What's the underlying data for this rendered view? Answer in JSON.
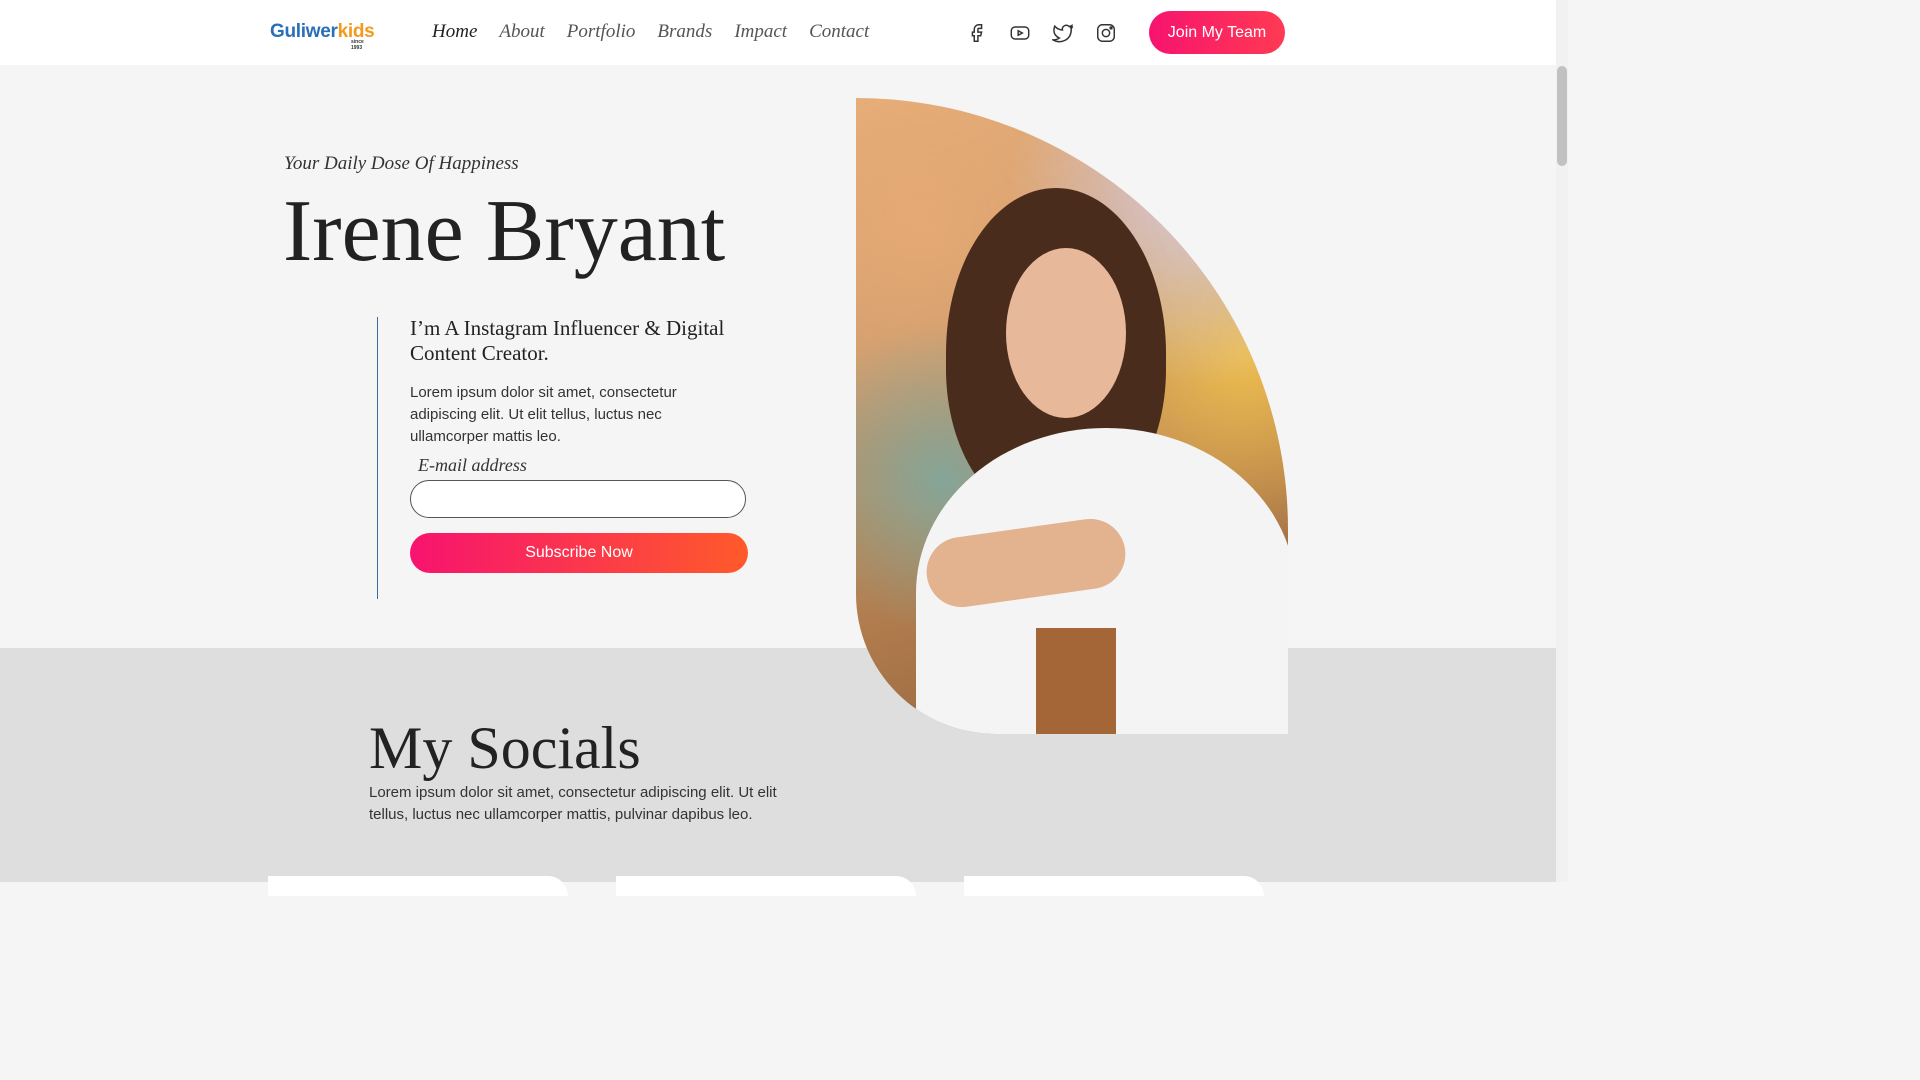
{
  "header": {
    "logo": {
      "main_a": "Guliwer",
      "main_b": "kids",
      "sub": "since 1993"
    },
    "nav": [
      {
        "label": "Home",
        "active": true
      },
      {
        "label": "About"
      },
      {
        "label": "Portfolio"
      },
      {
        "label": "Brands"
      },
      {
        "label": "Impact"
      },
      {
        "label": "Contact"
      }
    ],
    "social_icons": [
      "facebook-icon",
      "youtube-icon",
      "twitter-icon",
      "instagram-icon"
    ],
    "join_button": "Join My Team"
  },
  "hero": {
    "tagline": "Your Daily Dose Of Happiness",
    "name": "Irene Bryant",
    "subhead": "I’m A Instagram Influencer & Digital Content Creator.",
    "description": "Lorem ipsum dolor sit amet, consectetur adipiscing elit. Ut elit tellus, luctus nec ullamcorper mattis leo.",
    "email_label": "E-mail address",
    "email_value": "",
    "subscribe_button": "Subscribe Now"
  },
  "socials": {
    "title": "My Socials",
    "description": "Lorem ipsum dolor sit amet, consectetur adipiscing elit. Ut elit tellus, luctus nec ullamcorper mattis, pulvinar dapibus leo."
  },
  "colors": {
    "accent_gradient_start": "#f7136f",
    "accent_gradient_end": "#ff5a2a",
    "divider_line": "#3a6b9a"
  }
}
